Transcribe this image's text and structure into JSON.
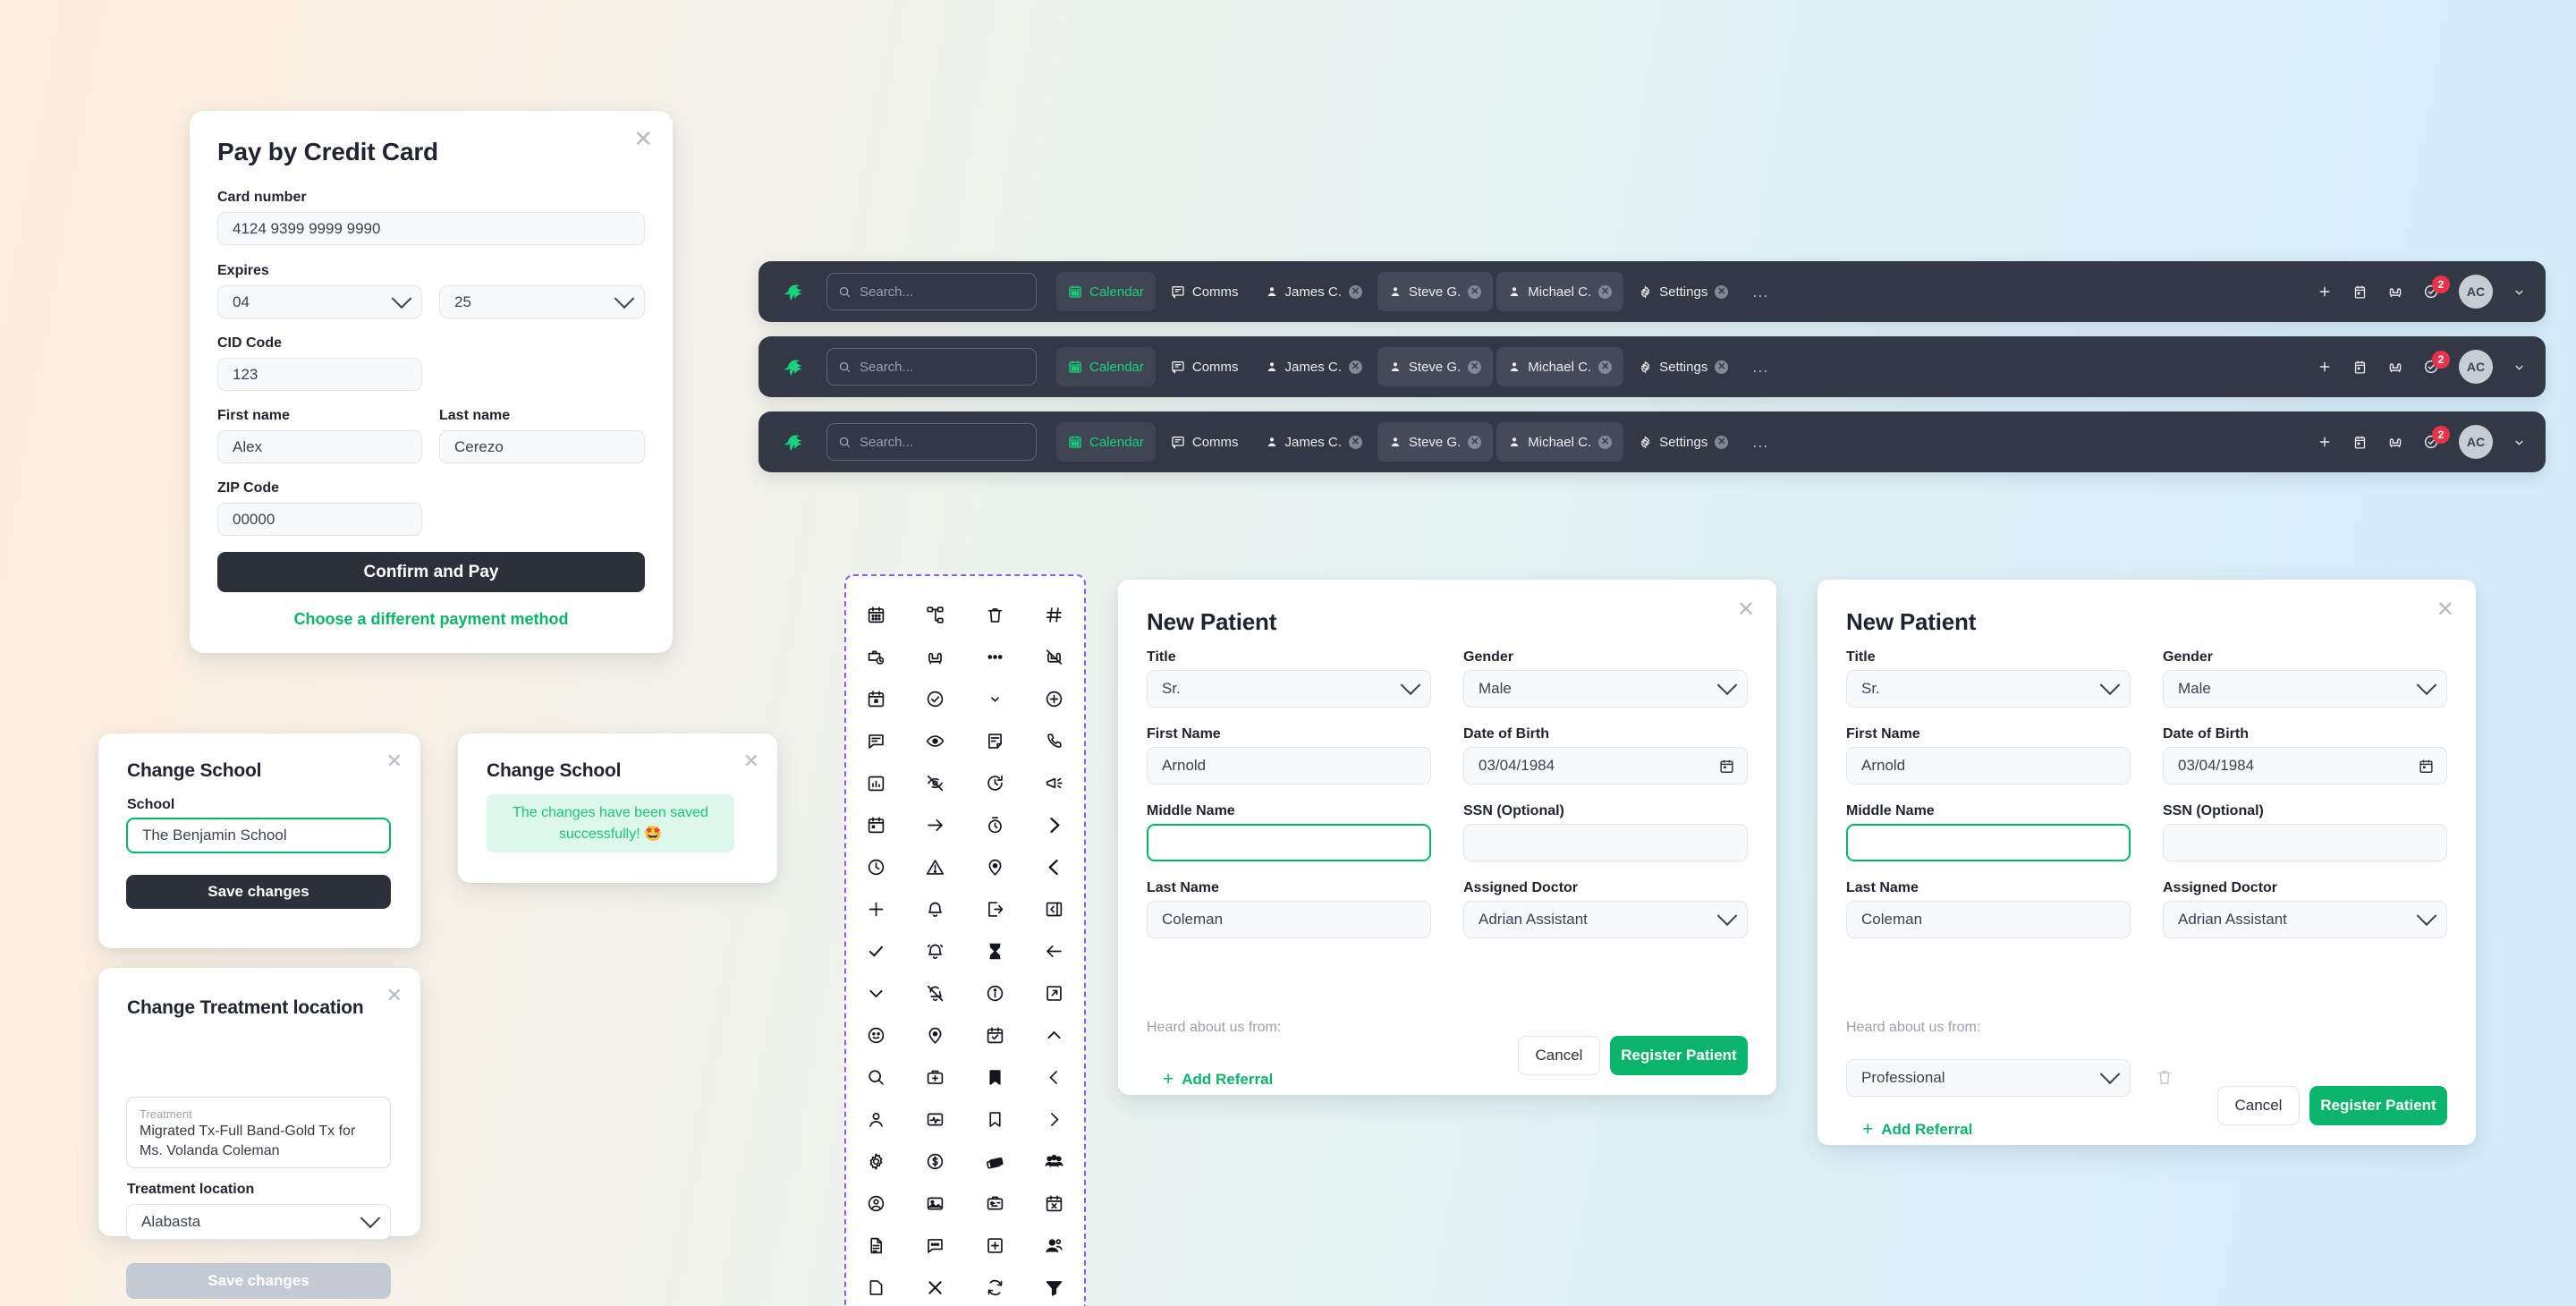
{
  "credit_card_dialog": {
    "title": "Pay by Credit Card",
    "card_number_label": "Card number",
    "card_number_value": "4124 9399 9999 9990",
    "expires_label": "Expires",
    "expires_month": "04",
    "expires_year": "25",
    "cid_label": "CID Code",
    "cid_value": "123",
    "first_name_label": "First name",
    "first_name_value": "Alex",
    "last_name_label": "Last name",
    "last_name_value": "Cerezo",
    "zip_label": "ZIP Code",
    "zip_value": "00000",
    "confirm_label": "Confirm and Pay",
    "alt_payment_label": "Choose a different payment method"
  },
  "change_school_dialog": {
    "title": "Change School",
    "school_label": "School",
    "school_value": "The Benjamin School",
    "save_label": "Save changes"
  },
  "change_school_success_dialog": {
    "title": "Change School",
    "success_message": "The changes have been saved successfully! 🤩"
  },
  "change_treatment_dialog": {
    "title": "Change Treatment location",
    "treatment_caption": "Treatment",
    "treatment_value": "Migrated Tx-Full Band-Gold Tx for Ms. Volanda Coleman",
    "location_label": "Treatment location",
    "location_value": "Alabasta",
    "save_label": "Save changes"
  },
  "navbar": {
    "search_placeholder": "Search...",
    "tabs": [
      {
        "label": "Calendar",
        "icon": "calendar-icon",
        "state": "active",
        "closable": false
      },
      {
        "label": "Comms",
        "icon": "comms-icon",
        "state": "plain",
        "closable": false
      },
      {
        "label": "James C.",
        "icon": "person-icon",
        "state": "plain",
        "closable": true
      },
      {
        "label": "Steve G.",
        "icon": "person-icon",
        "state": "chip",
        "closable": true
      },
      {
        "label": "Michael C.",
        "icon": "person-icon",
        "state": "chip",
        "closable": true
      },
      {
        "label": "Settings",
        "icon": "gear-icon",
        "state": "plain",
        "closable": true
      }
    ],
    "overflow_label": "...",
    "close_glyph": "✕",
    "actions": [
      {
        "name": "add-icon"
      },
      {
        "name": "calendar-day-icon"
      },
      {
        "name": "chair-icon"
      },
      {
        "name": "tasks-icon"
      }
    ],
    "notification_count": "2",
    "avatar_initials": "AC",
    "accent_green": "#18d27e",
    "bar_background": "#333944",
    "badge_color": "#e8334a"
  },
  "icon_grid": {
    "icons": [
      "calendar-icon",
      "org-chart-icon",
      "trash-icon",
      "hash-icon",
      "briefcase-clock-icon",
      "chair-icon",
      "dots-horizontal-icon",
      "chair-off-icon",
      "calendar-block-icon",
      "check-circle-icon",
      "chevron-down-small-icon",
      "plus-circle-icon",
      "message-lines-icon",
      "eye-icon",
      "note-icon",
      "phone-icon",
      "bar-chart-icon",
      "eye-off-icon",
      "clock-rotate-icon",
      "megaphone-icon",
      "calendar-square-icon",
      "arrow-right-icon",
      "stopwatch-icon",
      "chevron-right-bold-icon",
      "clock-icon",
      "warning-triangle-icon",
      "map-pin-icon",
      "chevron-left-bold-icon",
      "plus-icon",
      "bell-icon",
      "logout-icon",
      "collapse-panel-icon",
      "check-icon",
      "bell-ring-icon",
      "hourglass-icon",
      "arrow-left-icon",
      "chevron-down-icon",
      "bell-off-icon",
      "info-circle-icon",
      "external-link-icon",
      "smiley-icon",
      "location-pin-icon",
      "calendar-check-icon",
      "chevron-up-icon",
      "search-icon",
      "medical-bag-icon",
      "bookmark-filled-icon",
      "chevron-left-icon",
      "user-icon",
      "vitals-icon",
      "bookmark-icon",
      "chevron-right-icon",
      "gear-icon",
      "dollar-circle-icon",
      "payment-cards-icon",
      "group-people-icon",
      "account-circle-icon",
      "image-icon",
      "id-card-icon",
      "calendar-x-icon",
      "document-icon",
      "chat-dots-icon",
      "add-box-icon",
      "users-icon",
      "page-icon",
      "close-icon",
      "refresh-icon",
      "filter-icon"
    ]
  },
  "new_patient_form_a": {
    "title": "New Patient",
    "title_label": "Title",
    "title_value": "Sr.",
    "gender_label": "Gender",
    "gender_value": "Male",
    "first_name_label": "First Name",
    "first_name_value": "Arnold",
    "dob_label": "Date of Birth",
    "dob_value": "03/04/1984",
    "middle_name_label": "Middle Name",
    "middle_name_value": "",
    "ssn_label": "SSN (Optional)",
    "ssn_value": "",
    "last_name_label": "Last Name",
    "last_name_value": "Coleman",
    "doctor_label": "Assigned Doctor",
    "doctor_value": "Adrian Assistant",
    "heard_about_label": "Heard about us from:",
    "add_referral_label": "Add Referral",
    "cancel_label": "Cancel",
    "register_label": "Register Patient"
  },
  "new_patient_form_b": {
    "title": "New Patient",
    "title_label": "Title",
    "title_value": "Sr.",
    "gender_label": "Gender",
    "gender_value": "Male",
    "first_name_label": "First Name",
    "first_name_value": "Arnold",
    "dob_label": "Date of Birth",
    "dob_value": "03/04/1984",
    "middle_name_label": "Middle Name",
    "middle_name_value": "",
    "ssn_label": "SSN (Optional)",
    "ssn_value": "",
    "last_name_label": "Last Name",
    "last_name_value": "Coleman",
    "doctor_label": "Assigned Doctor",
    "doctor_value": "Adrian Assistant",
    "heard_about_label": "Heard about us from:",
    "referral_value": "Professional",
    "add_referral_label": "Add Referral",
    "cancel_label": "Cancel",
    "register_label": "Register Patient"
  }
}
